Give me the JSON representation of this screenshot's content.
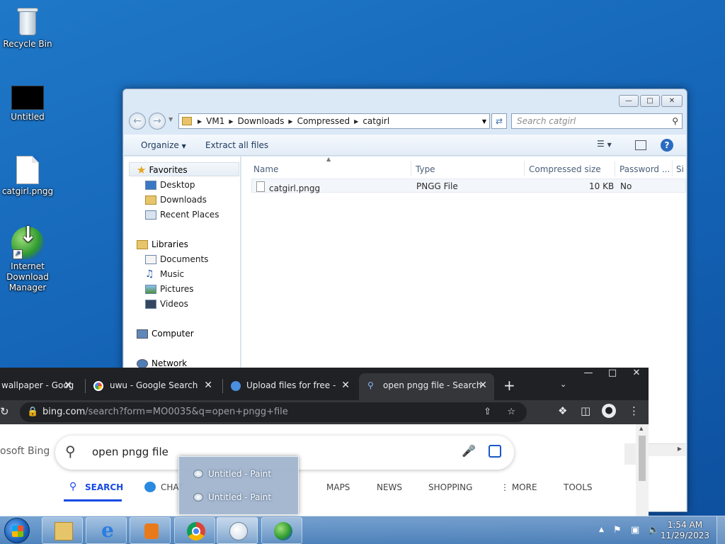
{
  "desktop": {
    "icons": [
      {
        "label": "Recycle Bin",
        "icon": "recycle-bin-icon"
      },
      {
        "label": "Untitled",
        "icon": "black-image-icon"
      },
      {
        "label": "catgirl.pngg",
        "icon": "blank-file-icon"
      },
      {
        "label": "Internet Download Manager",
        "icon": "idm-icon"
      }
    ]
  },
  "explorer": {
    "breadcrumb": [
      "VM1",
      "Downloads",
      "Compressed",
      "catgirl"
    ],
    "search_placeholder": "Search catgirl",
    "toolbar": {
      "organize": "Organize",
      "extract": "Extract all files"
    },
    "nav": {
      "favorites": "Favorites",
      "favorites_items": [
        "Desktop",
        "Downloads",
        "Recent Places"
      ],
      "libraries": "Libraries",
      "libraries_items": [
        "Documents",
        "Music",
        "Pictures",
        "Videos"
      ],
      "computer": "Computer",
      "network": "Network"
    },
    "columns": [
      "Name",
      "Type",
      "Compressed size",
      "Password ...",
      "Si"
    ],
    "files": [
      {
        "name": "catgirl.pngg",
        "type": "PNGG File",
        "size": "10 KB",
        "password": "No"
      }
    ]
  },
  "chrome": {
    "tabs": [
      {
        "title": "wallpaper - Goog",
        "favicon": "google-icon"
      },
      {
        "title": "uwu - Google Search",
        "favicon": "google-icon"
      },
      {
        "title": "Upload files for free - ca",
        "favicon": "upload-icon"
      },
      {
        "title": "open pngg file - Search",
        "favicon": "bing-search-icon",
        "active": true
      }
    ],
    "url_host": "bing.com",
    "url_path": "/search?form=MO0035&q=open+pngg+file",
    "bing_logo": "osoft Bing",
    "query": "open pngg file",
    "bing_tabs": [
      "SEARCH",
      "CHAT",
      "MAPS",
      "NEWS",
      "SHOPPING",
      "MORE",
      "TOOLS"
    ]
  },
  "popup": {
    "items": [
      "Untitled - Paint",
      "Untitled - Paint"
    ]
  },
  "taskbar": {
    "time": "1:54 AM",
    "date": "11/29/2023"
  }
}
